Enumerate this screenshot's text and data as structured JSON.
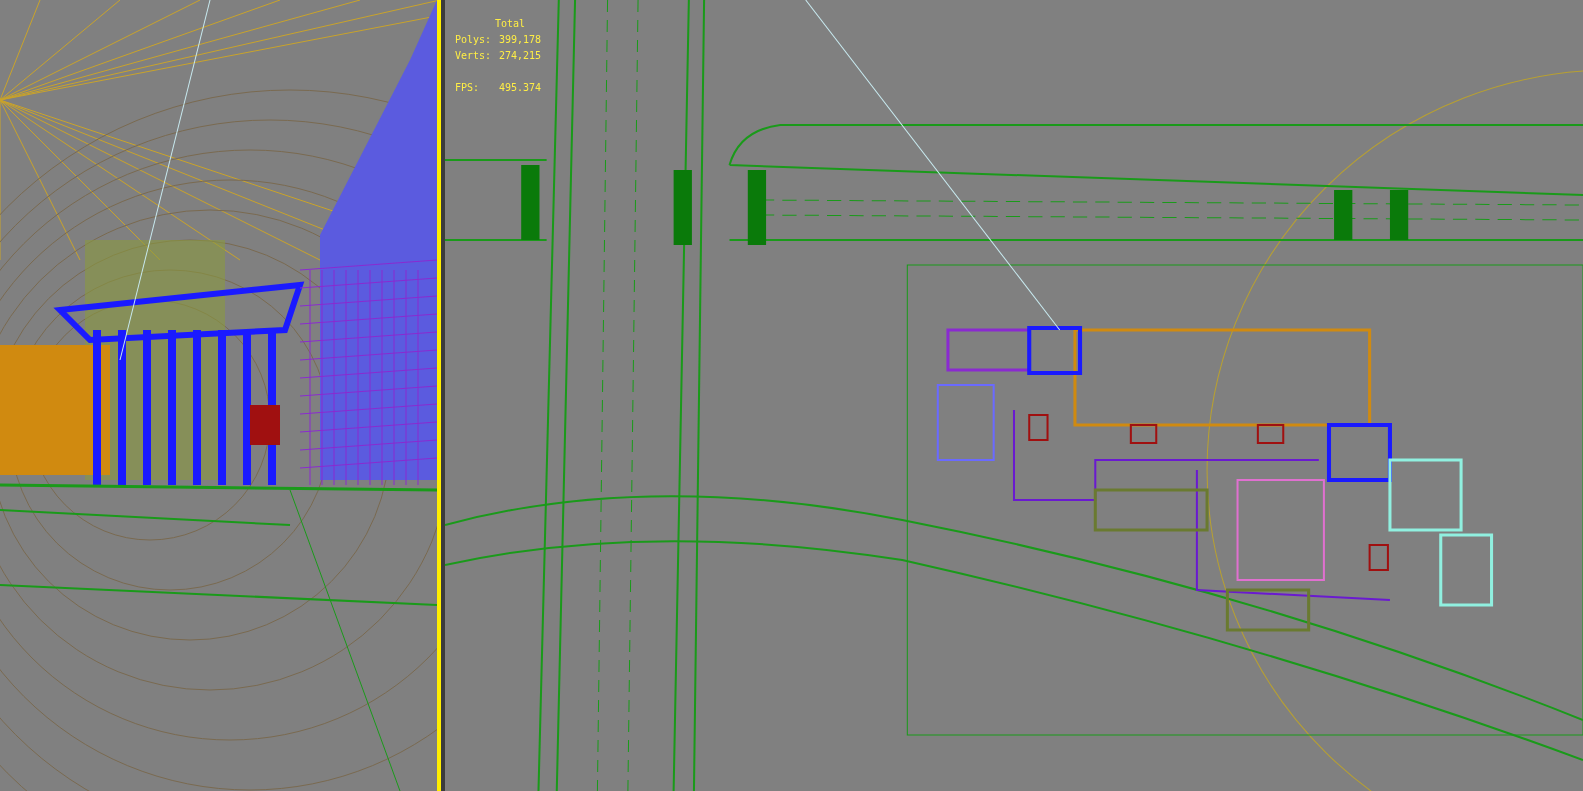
{
  "viewports": [
    {
      "kind": "perspective",
      "active": false
    },
    {
      "kind": "top",
      "active": true,
      "stats": {
        "heading": "Total",
        "lines": [
          {
            "label": "Polys:",
            "value": "399,178"
          },
          {
            "label": "Verts:",
            "value": "274,215"
          },
          {
            "label": "FPS:",
            "value": "495.374"
          }
        ]
      }
    }
  ]
}
